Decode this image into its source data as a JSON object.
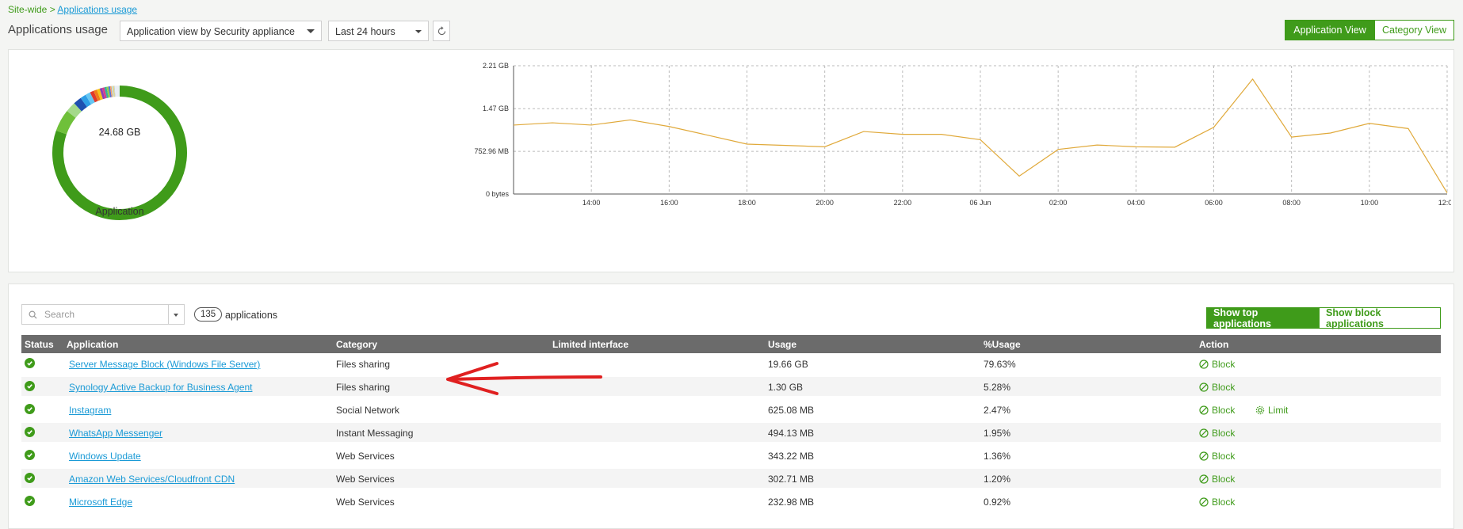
{
  "breadcrumb": {
    "root": "Site-wide >",
    "current": "Applications usage"
  },
  "header": {
    "title": "Applications usage",
    "view_select": "Application view by Security appliance",
    "range_select": "Last 24 hours",
    "app_view_button": "Application View",
    "category_view_button": "Category View"
  },
  "donut": {
    "total": "24.68 GB",
    "label": "Application",
    "slices": [
      {
        "value": 79.63,
        "color": "#3f9b1a"
      },
      {
        "value": 5.28,
        "color": "#6fc03a"
      },
      {
        "value": 2.47,
        "color": "#a4d98a"
      },
      {
        "value": 1.95,
        "color": "#1e4fb0"
      },
      {
        "value": 1.36,
        "color": "#2e9ee6"
      },
      {
        "value": 1.2,
        "color": "#66c6f2"
      },
      {
        "value": 0.92,
        "color": "#e03b2c"
      },
      {
        "value": 0.8,
        "color": "#f07d1b"
      },
      {
        "value": 0.7,
        "color": "#f5c518"
      },
      {
        "value": 0.6,
        "color": "#8b3fb5"
      },
      {
        "value": 0.55,
        "color": "#d63d8c"
      },
      {
        "value": 0.5,
        "color": "#33b39a"
      },
      {
        "value": 0.45,
        "color": "#97cc44"
      },
      {
        "value": 0.4,
        "color": "#5a6fd8"
      },
      {
        "value": 0.35,
        "color": "#f2a36b"
      },
      {
        "value": 0.3,
        "color": "#b7e0f5"
      },
      {
        "value": 0.25,
        "color": "#e7d56b"
      },
      {
        "value": 0.2,
        "color": "#cfcfcf"
      },
      {
        "value": 1.17,
        "color": "#e9eef3"
      }
    ]
  },
  "chart_data": {
    "type": "line",
    "title": "",
    "xlabel": "",
    "ylabel": "",
    "y_ticks": [
      "0 bytes",
      "752.96 MB",
      "1.47 GB",
      "2.21 GB"
    ],
    "x_ticks": [
      "14:00",
      "16:00",
      "18:00",
      "20:00",
      "22:00",
      "06 Jun",
      "02:00",
      "04:00",
      "06:00",
      "08:00",
      "10:00",
      "12:00"
    ],
    "ylim_mb": [
      0,
      2262
    ],
    "x": [
      "12:00",
      "13:00",
      "14:00",
      "15:00",
      "16:00",
      "17:00",
      "18:00",
      "19:00",
      "20:00",
      "21:00",
      "22:00",
      "23:00",
      "00:00",
      "01:00",
      "02:00",
      "03:00",
      "04:00",
      "05:00",
      "06:00",
      "07:00",
      "08:00",
      "09:00",
      "10:00",
      "11:00",
      "12:00"
    ],
    "series": [
      {
        "values_mb": [
          1216,
          1256,
          1216,
          1306,
          1190,
          1036,
          880,
          857,
          833,
          1102,
          1052,
          1052,
          958,
          316,
          786,
          864,
          833,
          826,
          1176,
          2026,
          1004,
          1075,
          1246,
          1154,
          20
        ]
      }
    ],
    "line_color": "#e0a93a",
    "grid": true
  },
  "list": {
    "search_placeholder": "Search",
    "count": "135",
    "count_label": "applications",
    "show_top_button": "Show top applications",
    "show_block_button": "Show block applications",
    "columns": [
      "Status",
      "Application",
      "Category",
      "Limited interface",
      "Usage",
      "%Usage",
      "Action"
    ],
    "rows": [
      {
        "app": "Server Message Block (Windows File Server)",
        "category": "Files sharing",
        "iface": "",
        "usage": "19.66 GB",
        "pct": "79.63%",
        "block": "Block",
        "limit": ""
      },
      {
        "app": "Synology Active Backup for Business Agent",
        "category": "Files sharing",
        "iface": "",
        "usage": "1.30 GB",
        "pct": "5.28%",
        "block": "Block",
        "limit": ""
      },
      {
        "app": "Instagram",
        "category": "Social Network",
        "iface": "",
        "usage": "625.08 MB",
        "pct": "2.47%",
        "block": "Block",
        "limit": "Limit"
      },
      {
        "app": "WhatsApp Messenger",
        "category": "Instant Messaging",
        "iface": "",
        "usage": "494.13 MB",
        "pct": "1.95%",
        "block": "Block",
        "limit": ""
      },
      {
        "app": "Windows Update",
        "category": "Web Services",
        "iface": "",
        "usage": "343.22 MB",
        "pct": "1.36%",
        "block": "Block",
        "limit": ""
      },
      {
        "app": "Amazon Web Services/Cloudfront CDN",
        "category": "Web Services",
        "iface": "",
        "usage": "302.71 MB",
        "pct": "1.20%",
        "block": "Block",
        "limit": ""
      },
      {
        "app": "Microsoft Edge",
        "category": "Web Services",
        "iface": "",
        "usage": "232.98 MB",
        "pct": "0.92%",
        "block": "Block",
        "limit": ""
      }
    ]
  },
  "annotation": {
    "arrow_color": "#e02020"
  }
}
